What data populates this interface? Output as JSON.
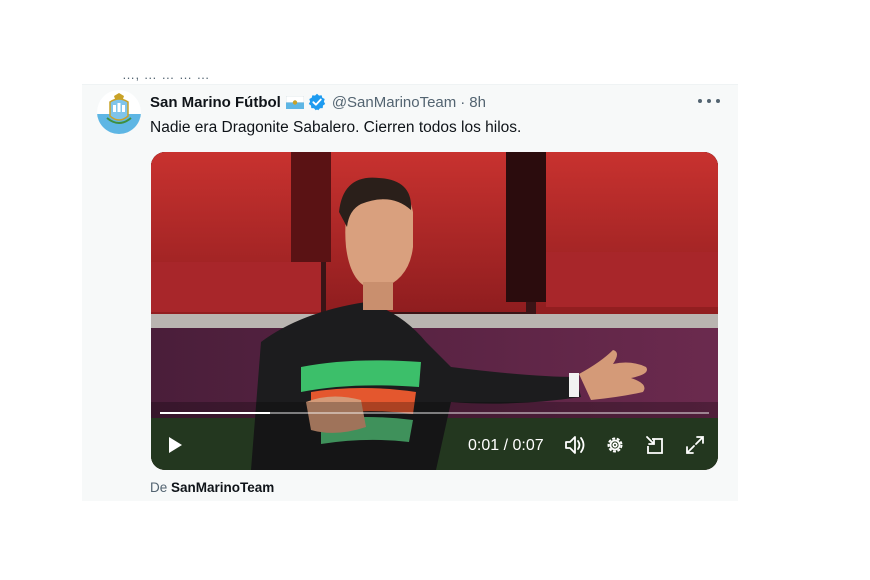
{
  "clipped_context_text": "…, … … … …",
  "tweet": {
    "display_name": "San Marino Fútbol",
    "handle": "@SanMarinoTeam",
    "separator": "·",
    "time": "8h",
    "text": "Nadie era Dragonite Sabalero. Cierren todos los hilos."
  },
  "video": {
    "progress": 0.2,
    "current_time": "0:01",
    "divider": "/",
    "duration": "0:07"
  },
  "source": {
    "prefix": "De",
    "user": "SanMarinoTeam"
  },
  "colors": {
    "verified": "#1d9bf0",
    "text_secondary": "#536471",
    "card_bg": "#f7f9f9"
  },
  "icons": [
    "san-marino-crest-icon",
    "san-marino-flag-icon",
    "verified-badge-icon",
    "more-options-icon",
    "play-icon",
    "volume-icon",
    "settings-icon",
    "pip-icon",
    "fullscreen-icon"
  ]
}
